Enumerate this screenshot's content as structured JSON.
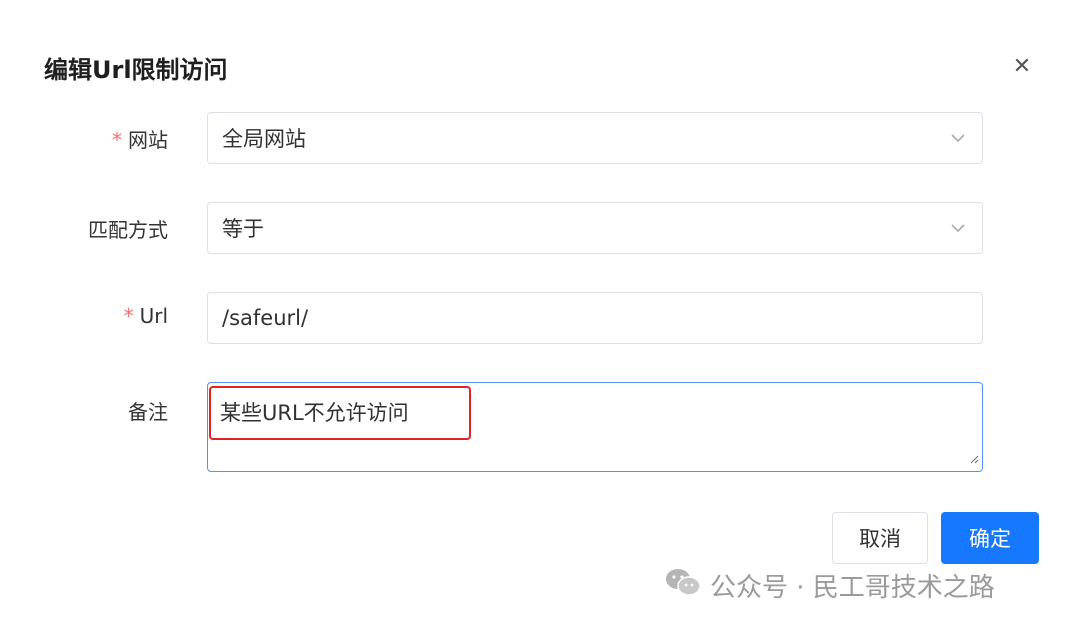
{
  "dialog": {
    "title": "编辑Url限制访问",
    "close_icon": "close-icon"
  },
  "form": {
    "site": {
      "required_mark": "*",
      "label": "网站",
      "value": "全局网站"
    },
    "match": {
      "label": "匹配方式",
      "value": "等于"
    },
    "url": {
      "required_mark": "*",
      "label": "Url",
      "value": "/safeurl/"
    },
    "remark": {
      "label": "备注",
      "value": "某些URL不允许访问"
    }
  },
  "buttons": {
    "cancel": "取消",
    "confirm": "确定"
  },
  "watermark": {
    "icon": "wechat-icon",
    "text": "公众号 · 民工哥技术之路"
  },
  "colors": {
    "primary": "#1677ff",
    "required": "#f56c6c",
    "highlight": "#e02424",
    "focus_border": "#5b8ff9"
  }
}
